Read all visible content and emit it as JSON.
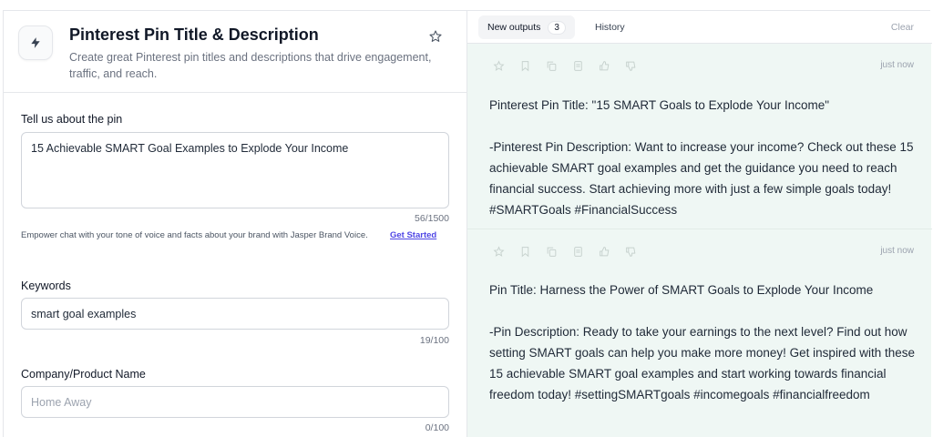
{
  "header": {
    "title": "Pinterest Pin Title & Description",
    "subtitle": "Create great Pinterest pin titles and descriptions that drive engagement, traffic, and reach.",
    "icon": "bolt-icon",
    "favorite_icon": "star-outline-icon"
  },
  "form": {
    "pin": {
      "label": "Tell us about the pin",
      "value": "15 Achievable SMART Goal Examples to Explode Your Income",
      "counter": "56/1500"
    },
    "brand_voice": {
      "text": "Empower chat with your tone of voice and facts about your brand with Jasper Brand Voice.",
      "link": "Get Started"
    },
    "keywords": {
      "label": "Keywords",
      "value": "smart goal examples",
      "counter": "19/100"
    },
    "company": {
      "label": "Company/Product Name",
      "placeholder": "Home Away",
      "counter": "0/100"
    }
  },
  "outputs_panel": {
    "tabs": {
      "new_outputs_label": "New outputs",
      "new_outputs_count": "3",
      "history_label": "History"
    },
    "clear_label": "Clear",
    "action_icons": [
      "star-icon",
      "bookmark-icon",
      "copy-icon",
      "document-icon",
      "thumbs-up-icon",
      "thumbs-down-icon"
    ],
    "items": [
      {
        "time": "just now",
        "title_line": "Pinterest Pin Title: \"15 SMART Goals to Explode Your Income\"",
        "description": "-Pinterest Pin Description: Want to increase your income? Check out these 15 achievable SMART goal examples and get the guidance you need to reach financial success. Start achieving more with just a few simple goals today! #SMARTGoals #FinancialSuccess"
      },
      {
        "time": "just now",
        "title_line": "Pin Title: Harness the Power of SMART Goals to Explode Your Income",
        "description": "-Pin Description: Ready to take your earnings to the next level? Find out how setting SMART goals can help you make more money! Get inspired with these 15 achievable SMART goal examples and start working towards financial freedom today! #settingSMARTgoals #incomegoals #financialfreedom"
      }
    ]
  },
  "colors": {
    "accent_link": "#4f46e5",
    "output_bg": "#eff7f4"
  }
}
